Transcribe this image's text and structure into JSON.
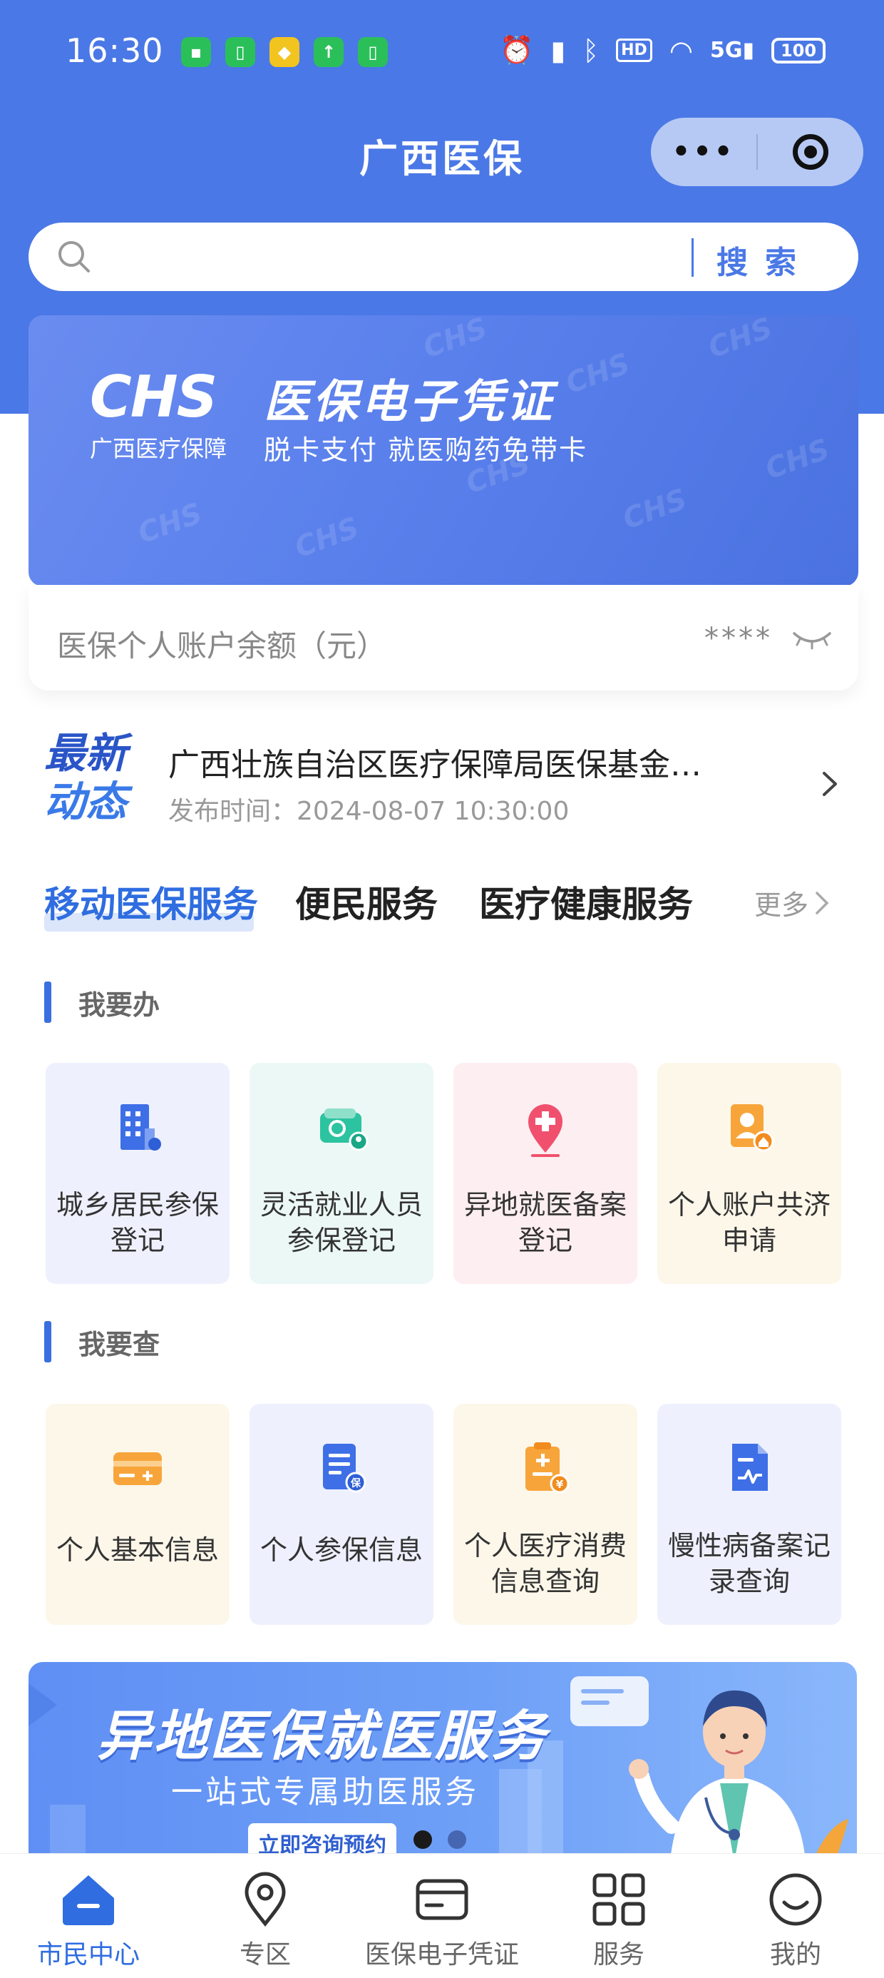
{
  "status_bar": {
    "time": "16:30",
    "battery": "100",
    "network": "5G",
    "hd": "HD"
  },
  "header": {
    "title": "广西医保",
    "capsule_more": "•••"
  },
  "search": {
    "placeholder": "",
    "button_label": "搜索"
  },
  "ehs_banner": {
    "logo": "CHS",
    "title": "医保电子凭证",
    "org": "广西医疗保障",
    "subtitle": "脱卡支付 就医购药免带卡"
  },
  "balance": {
    "label": "医保个人账户余额（元）",
    "value": "****"
  },
  "news": {
    "logo_top": "最新",
    "logo_bottom": "动态",
    "title": "广西壮族自治区医疗保障局医保基金…",
    "time": "发布时间：2024-08-07 10:30:00"
  },
  "tabs": {
    "items": [
      {
        "label": "移动医保服务",
        "active": true
      },
      {
        "label": "便民服务",
        "active": false
      },
      {
        "label": "医疗健康服务",
        "active": false
      }
    ],
    "more_label": "更多"
  },
  "section_do": {
    "title": "我要办",
    "cards": [
      {
        "label": "城乡居民参保登记",
        "icon": "building-icon"
      },
      {
        "label": "灵活就业人员参保登记",
        "icon": "wallet-icon"
      },
      {
        "label": "异地就医备案登记",
        "icon": "medical-pin-icon"
      },
      {
        "label": "个人账户共济申请",
        "icon": "account-share-icon"
      }
    ]
  },
  "section_query": {
    "title": "我要查",
    "cards": [
      {
        "label": "个人基本信息",
        "icon": "card-icon"
      },
      {
        "label": "个人参保信息",
        "icon": "insurance-doc-icon"
      },
      {
        "label": "个人医疗消费信息查询",
        "icon": "bill-icon"
      },
      {
        "label": "慢性病备案记录查询",
        "icon": "chart-doc-icon"
      }
    ]
  },
  "promo": {
    "title": "异地医保就医服务",
    "subtitle": "一站式专属助医服务",
    "button": "立即咨询预约"
  },
  "bottom_nav": {
    "items": [
      {
        "label": "市民中心",
        "active": true
      },
      {
        "label": "专区",
        "active": false
      },
      {
        "label": "医保电子凭证",
        "active": false
      },
      {
        "label": "服务",
        "active": false
      },
      {
        "label": "我的",
        "active": false
      }
    ]
  },
  "colors": {
    "brand": "#4a78e6",
    "active_tab": "#2f6de0"
  }
}
